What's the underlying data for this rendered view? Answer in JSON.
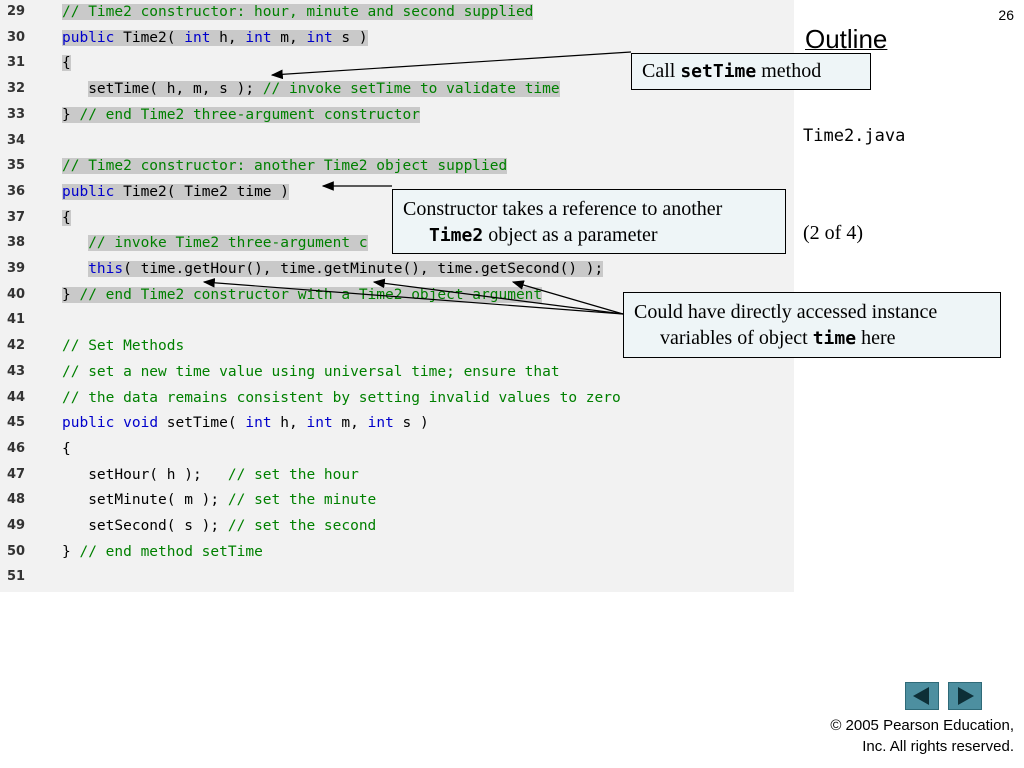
{
  "slide": {
    "number": "26",
    "outline_title": "Outline",
    "file_name": "Time2.java",
    "page_indicator": "(2 of 4)",
    "copyright_line1": "© 2005 Pearson Education,",
    "copyright_line2": "Inc.  All rights reserved."
  },
  "code_lines": [
    {
      "num": "29",
      "tokens": [
        {
          "t": "// Time2 constructor: hour, minute and second supplied",
          "c": "cm",
          "h": true
        }
      ]
    },
    {
      "num": "30",
      "tokens": [
        {
          "t": "public",
          "c": "kw",
          "h": true
        },
        {
          "t": " Time2( ",
          "c": "tx",
          "h": true
        },
        {
          "t": "int",
          "c": "kw",
          "h": true
        },
        {
          "t": " h, ",
          "c": "tx",
          "h": true
        },
        {
          "t": "int",
          "c": "kw",
          "h": true
        },
        {
          "t": " m, ",
          "c": "tx",
          "h": true
        },
        {
          "t": "int",
          "c": "kw",
          "h": true
        },
        {
          "t": " s )",
          "c": "tx",
          "h": true
        }
      ]
    },
    {
      "num": "31",
      "tokens": [
        {
          "t": "{",
          "c": "tx",
          "h": true
        }
      ]
    },
    {
      "num": "32",
      "tokens": [
        {
          "t": "   ",
          "c": "tx",
          "h": false
        },
        {
          "t": "setTime( h, m, s ); ",
          "c": "tx",
          "h": true
        },
        {
          "t": "// invoke setTime to validate time",
          "c": "cm",
          "h": true
        }
      ]
    },
    {
      "num": "33",
      "tokens": [
        {
          "t": "} ",
          "c": "tx",
          "h": true
        },
        {
          "t": "// end Time2 three-argument constructor",
          "c": "cm",
          "h": true
        }
      ]
    },
    {
      "num": "34",
      "tokens": []
    },
    {
      "num": "35",
      "tokens": [
        {
          "t": "// Time2 constructor: another Time2 object supplied",
          "c": "cm",
          "h": true
        }
      ]
    },
    {
      "num": "36",
      "tokens": [
        {
          "t": "public",
          "c": "kw",
          "h": true
        },
        {
          "t": " Time2( Time2 time )",
          "c": "tx",
          "h": true
        }
      ]
    },
    {
      "num": "37",
      "tokens": [
        {
          "t": "{",
          "c": "tx",
          "h": true
        }
      ]
    },
    {
      "num": "38",
      "tokens": [
        {
          "t": "   ",
          "c": "tx",
          "h": false
        },
        {
          "t": "// invoke Time2 three-argument c",
          "c": "cm",
          "h": true
        }
      ]
    },
    {
      "num": "39",
      "tokens": [
        {
          "t": "   ",
          "c": "tx",
          "h": false
        },
        {
          "t": "this",
          "c": "kw",
          "h": true
        },
        {
          "t": "( time.getHour(), time.getMinute(), time.getSecond() );",
          "c": "tx",
          "h": true
        }
      ]
    },
    {
      "num": "40",
      "tokens": [
        {
          "t": "} ",
          "c": "tx",
          "h": true
        },
        {
          "t": "// end Time2 constructor with a Time2 object argument",
          "c": "cm",
          "h": true
        }
      ]
    },
    {
      "num": "41",
      "tokens": []
    },
    {
      "num": "42",
      "tokens": [
        {
          "t": "// Set Methods",
          "c": "cm",
          "h": false
        }
      ]
    },
    {
      "num": "43",
      "tokens": [
        {
          "t": "// set a new time value using universal time; ensure that",
          "c": "cm",
          "h": false
        }
      ]
    },
    {
      "num": "44",
      "tokens": [
        {
          "t": "// the data remains consistent by setting invalid values to zero",
          "c": "cm",
          "h": false
        }
      ]
    },
    {
      "num": "45",
      "tokens": [
        {
          "t": "public",
          "c": "kw",
          "h": false
        },
        {
          "t": " ",
          "c": "tx",
          "h": false
        },
        {
          "t": "void",
          "c": "kw",
          "h": false
        },
        {
          "t": " setTime( ",
          "c": "tx",
          "h": false
        },
        {
          "t": "int",
          "c": "kw",
          "h": false
        },
        {
          "t": " h, ",
          "c": "tx",
          "h": false
        },
        {
          "t": "int",
          "c": "kw",
          "h": false
        },
        {
          "t": " m, ",
          "c": "tx",
          "h": false
        },
        {
          "t": "int",
          "c": "kw",
          "h": false
        },
        {
          "t": " s )",
          "c": "tx",
          "h": false
        }
      ]
    },
    {
      "num": "46",
      "tokens": [
        {
          "t": "{",
          "c": "tx",
          "h": false
        }
      ]
    },
    {
      "num": "47",
      "tokens": [
        {
          "t": "   setHour( h );   ",
          "c": "tx",
          "h": false
        },
        {
          "t": "// set the hour",
          "c": "cm",
          "h": false
        }
      ]
    },
    {
      "num": "48",
      "tokens": [
        {
          "t": "   setMinute( m ); ",
          "c": "tx",
          "h": false
        },
        {
          "t": "// set the minute",
          "c": "cm",
          "h": false
        }
      ]
    },
    {
      "num": "49",
      "tokens": [
        {
          "t": "   setSecond( s ); ",
          "c": "tx",
          "h": false
        },
        {
          "t": "// set the second",
          "c": "cm",
          "h": false
        }
      ]
    },
    {
      "num": "50",
      "tokens": [
        {
          "t": "} ",
          "c": "tx",
          "h": false
        },
        {
          "t": "// end method setTime",
          "c": "cm",
          "h": false
        }
      ]
    },
    {
      "num": "51",
      "tokens": []
    }
  ],
  "callouts": {
    "settime": {
      "prefix": "Call ",
      "code": "setTime",
      "suffix": " method"
    },
    "constructor": {
      "line1": "Constructor takes a reference to another",
      "code": "Time2",
      "line2_suffix": " object as a parameter"
    },
    "direct_access": {
      "line1": "Could have directly accessed instance",
      "line2_prefix": "variables of object ",
      "code": "time",
      "line2_suffix": " here"
    }
  },
  "nav": {
    "prev_icon": "arrow-left-icon",
    "next_icon": "arrow-right-icon",
    "button_color": "#4d8fa0"
  },
  "colors": {
    "keyword": "#0000cc",
    "comment": "#008000",
    "highlight": "#c9c9c9",
    "code_background": "#f2f2f2",
    "callout_background": "#eef5f7"
  }
}
